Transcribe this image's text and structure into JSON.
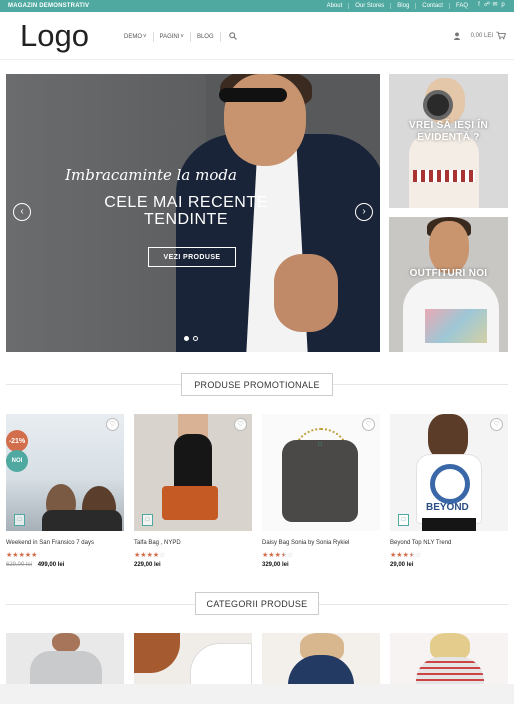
{
  "topbar": {
    "brand": "MAGAZIN DEMONSTRATIV",
    "links": [
      "About",
      "Our Stores",
      "Blog",
      "Contact",
      "FAQ"
    ],
    "social_icons": [
      "facebook-icon",
      "twitter-icon",
      "email-icon",
      "pinterest-icon"
    ]
  },
  "header": {
    "logo": "Logo",
    "nav": [
      "DEMO",
      "PAGINI",
      "BLOG"
    ],
    "cart_total": "0,00 LEI"
  },
  "hero": {
    "subtitle": "Imbracaminte la moda",
    "title": "CELE MAI RECENTE TENDINTE",
    "cta": "VEZI PRODUSE",
    "slide_count": 2,
    "active_slide": 1
  },
  "banners": [
    {
      "title": "VREI SĂ IEȘI ÎN EVIDENȚĂ ?"
    },
    {
      "title": "OUTFITURI NOI"
    }
  ],
  "sections": {
    "promo_title": "PRODUSE PROMOTIONALE",
    "categories_title": "CATEGORII PRODUSE"
  },
  "products": [
    {
      "name": "Weekend in San Fransico 7 days",
      "rating": 5,
      "old_price": "629,00 lei",
      "price": "499,00 lei",
      "sale_badge": "-21%",
      "new_badge": "NOI"
    },
    {
      "name": "Talfa Bag , NYPD",
      "rating": 4,
      "old_price": "",
      "price": "229,00 lei",
      "sale_badge": "",
      "new_badge": ""
    },
    {
      "name": "Daisy Bag Sonia by Sonia Rykiel",
      "rating": 3.5,
      "old_price": "",
      "price": "329,00 lei",
      "sale_badge": "",
      "new_badge": ""
    },
    {
      "name": "Beyond Top NLY Trend",
      "rating": 3.5,
      "old_price": "",
      "price": "29,00 lei",
      "sale_badge": "",
      "new_badge": ""
    }
  ],
  "product_art": {
    "tee_print": "BEYOND"
  },
  "colors": {
    "accent": "#4fa9a0",
    "sale": "#d26e4b",
    "star": "#d26e4b"
  }
}
